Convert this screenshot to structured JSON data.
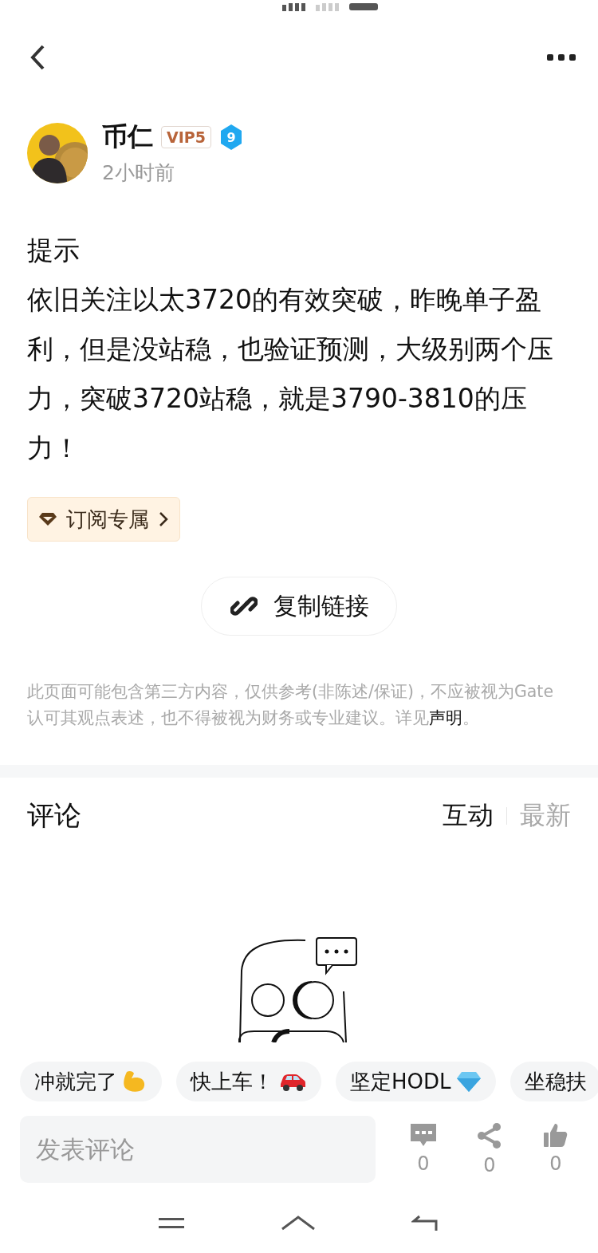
{
  "author": {
    "name": "币仁",
    "vip": "VIP5",
    "level": "9",
    "time": "2小时前"
  },
  "post": {
    "paragraphs": [
      "提示",
      "依旧关注以太3720的有效突破，昨晚单子盈利，但是没站稳，也验证预测，大级别两个压力，突破3720站稳，就是3790-3810的压力！"
    ]
  },
  "subscribe_chip": {
    "label": "订阅专属"
  },
  "copy_link_button": {
    "label": "复制链接"
  },
  "disclaimer": {
    "text": "此页面可能包含第三方内容，仅供参考(非陈述/保证)，不应被视为Gate认可其观点表述，也不得被视为财务或专业建议。详见",
    "link": "声明",
    "end": "。"
  },
  "comments": {
    "title": "评论",
    "tabs": [
      {
        "label": "互动",
        "selected": true
      },
      {
        "label": "最新",
        "selected": false
      }
    ]
  },
  "quick_replies": [
    {
      "label": "冲就完了",
      "kind": "muscle"
    },
    {
      "label": "快上车！",
      "kind": "car"
    },
    {
      "label": "坚定HODL",
      "kind": "gem"
    },
    {
      "label": "坐稳扶",
      "kind": "none"
    }
  ],
  "comment_bar": {
    "placeholder": "发表评论",
    "actions": [
      {
        "kind": "comment",
        "count": "0"
      },
      {
        "kind": "share",
        "count": "0"
      },
      {
        "kind": "like",
        "count": "0"
      }
    ]
  }
}
